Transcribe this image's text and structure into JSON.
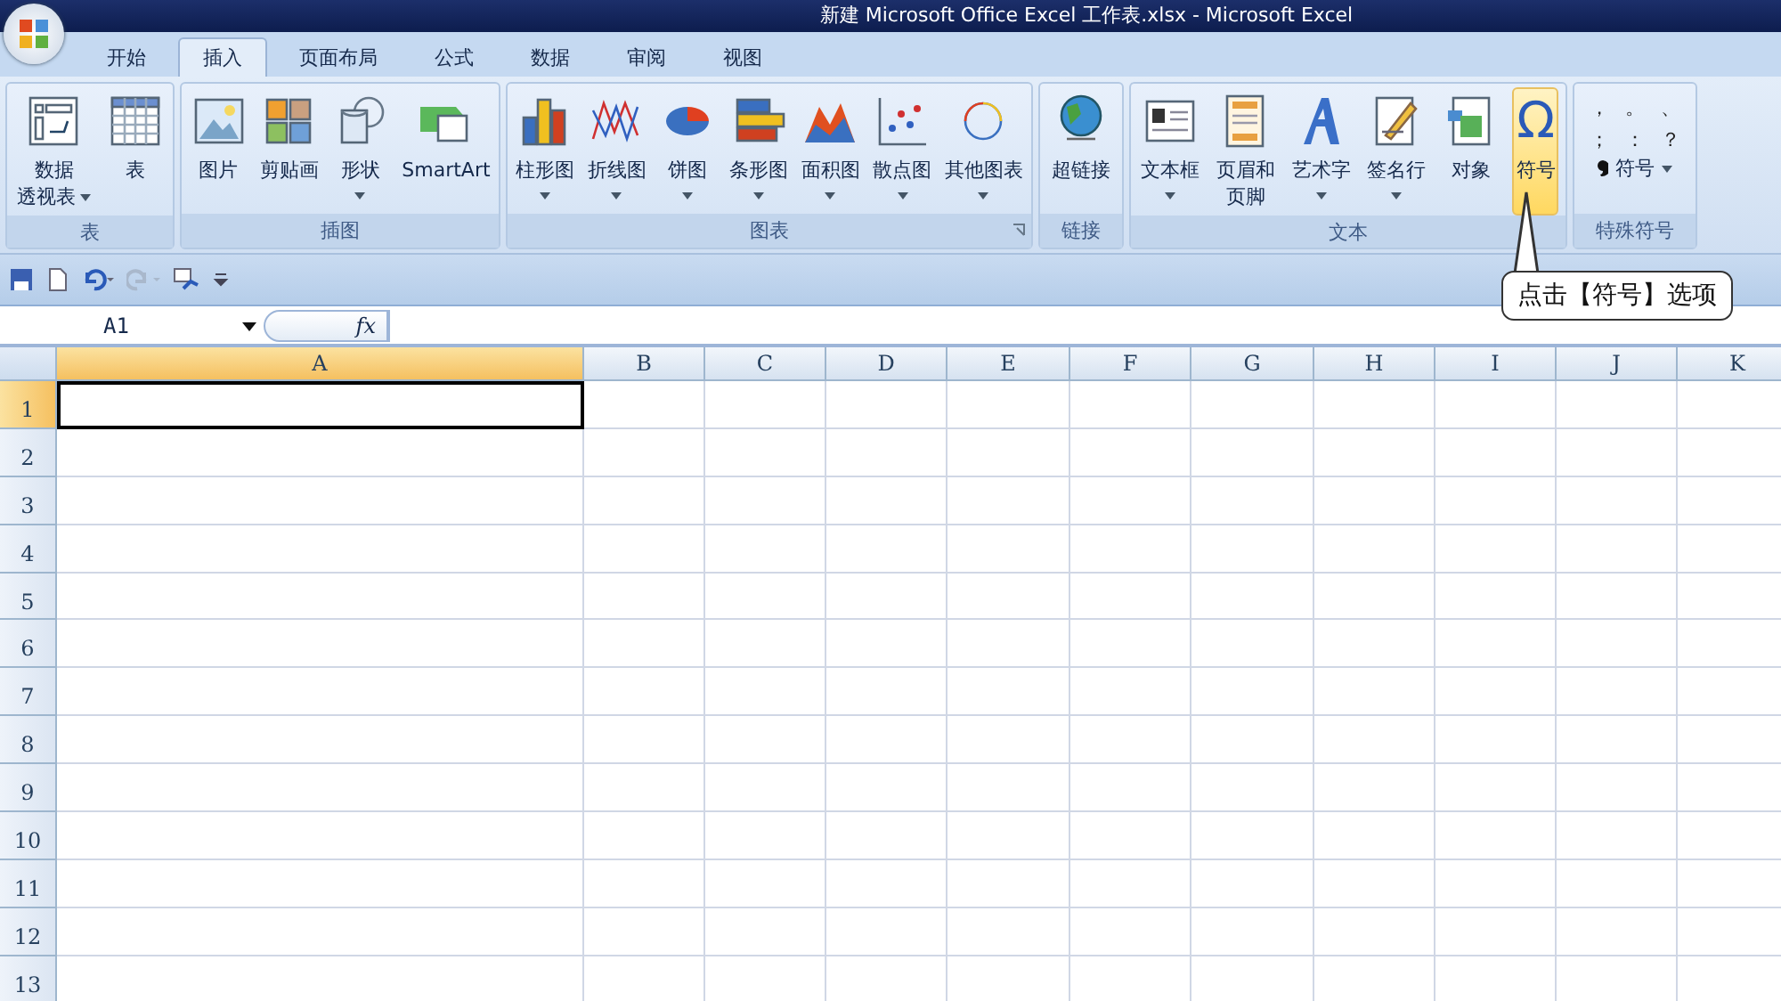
{
  "window": {
    "title": "新建 Microsoft Office Excel 工作表.xlsx - Microsoft Excel"
  },
  "tabs": [
    {
      "label": "开始",
      "selected": false
    },
    {
      "label": "插入",
      "selected": true
    },
    {
      "label": "页面布局",
      "selected": false
    },
    {
      "label": "公式",
      "selected": false
    },
    {
      "label": "数据",
      "selected": false
    },
    {
      "label": "审阅",
      "selected": false
    },
    {
      "label": "视图",
      "selected": false
    }
  ],
  "ribbon": {
    "groups": [
      {
        "name": "表",
        "launcher": false,
        "buttons": [
          {
            "lines": [
              "数据",
              "透视表"
            ],
            "dropdown": true,
            "selected": false
          },
          {
            "lines": [
              "表"
            ],
            "dropdown": false,
            "selected": false
          }
        ]
      },
      {
        "name": "插图",
        "launcher": false,
        "buttons": [
          {
            "lines": [
              "图片"
            ],
            "dropdown": false,
            "selected": false
          },
          {
            "lines": [
              "剪贴画"
            ],
            "dropdown": false,
            "selected": false
          },
          {
            "lines": [
              "形状"
            ],
            "dropdown": true,
            "selected": false
          },
          {
            "lines": [
              "SmartArt"
            ],
            "dropdown": false,
            "selected": false
          }
        ]
      },
      {
        "name": "图表",
        "launcher": true,
        "buttons": [
          {
            "lines": [
              "柱形图"
            ],
            "dropdown": true,
            "selected": false
          },
          {
            "lines": [
              "折线图"
            ],
            "dropdown": true,
            "selected": false
          },
          {
            "lines": [
              "饼图"
            ],
            "dropdown": true,
            "selected": false
          },
          {
            "lines": [
              "条形图"
            ],
            "dropdown": true,
            "selected": false
          },
          {
            "lines": [
              "面积图"
            ],
            "dropdown": true,
            "selected": false
          },
          {
            "lines": [
              "散点图"
            ],
            "dropdown": true,
            "selected": false
          },
          {
            "lines": [
              "其他图表"
            ],
            "dropdown": true,
            "selected": false
          }
        ]
      },
      {
        "name": "链接",
        "launcher": false,
        "buttons": [
          {
            "lines": [
              "超链接"
            ],
            "dropdown": false,
            "selected": false
          }
        ]
      },
      {
        "name": "文本",
        "launcher": false,
        "buttons": [
          {
            "lines": [
              "文本框"
            ],
            "dropdown": true,
            "selected": false
          },
          {
            "lines": [
              "页眉和",
              "页脚"
            ],
            "dropdown": false,
            "selected": false
          },
          {
            "lines": [
              "艺术字"
            ],
            "dropdown": true,
            "selected": false
          },
          {
            "lines": [
              "签名行"
            ],
            "dropdown": true,
            "selected": false
          },
          {
            "lines": [
              "对象"
            ],
            "dropdown": false,
            "selected": false
          },
          {
            "lines": [
              "符号"
            ],
            "dropdown": false,
            "selected": true,
            "glyph": "Ω"
          }
        ]
      }
    ],
    "special_symbols": {
      "name": "特殊符号",
      "symbols": [
        "，",
        "。",
        "、",
        "；",
        "：",
        "？"
      ],
      "menu": {
        "label": "符号",
        "dropdown": true
      }
    }
  },
  "formula_bar": {
    "name_box": "A1",
    "fx": "fx"
  },
  "sheet": {
    "columns": [
      {
        "label": "A",
        "selected": true
      },
      {
        "label": "B",
        "selected": false
      },
      {
        "label": "C",
        "selected": false
      },
      {
        "label": "D",
        "selected": false
      },
      {
        "label": "E",
        "selected": false
      },
      {
        "label": "F",
        "selected": false
      },
      {
        "label": "G",
        "selected": false
      },
      {
        "label": "H",
        "selected": false
      },
      {
        "label": "I",
        "selected": false
      },
      {
        "label": "J",
        "selected": false
      },
      {
        "label": "K",
        "selected": false
      }
    ],
    "rows": [
      {
        "label": "1",
        "selected": true
      },
      {
        "label": "2",
        "selected": false
      },
      {
        "label": "3",
        "selected": false
      },
      {
        "label": "4",
        "selected": false
      },
      {
        "label": "5",
        "selected": false
      },
      {
        "label": "6",
        "selected": false
      },
      {
        "label": "7",
        "selected": false
      },
      {
        "label": "8",
        "selected": false
      },
      {
        "label": "9",
        "selected": false
      },
      {
        "label": "10",
        "selected": false
      },
      {
        "label": "11",
        "selected": false
      },
      {
        "label": "12",
        "selected": false
      },
      {
        "label": "13",
        "selected": false
      }
    ]
  },
  "callout": {
    "text": "点击【符号】选项"
  }
}
